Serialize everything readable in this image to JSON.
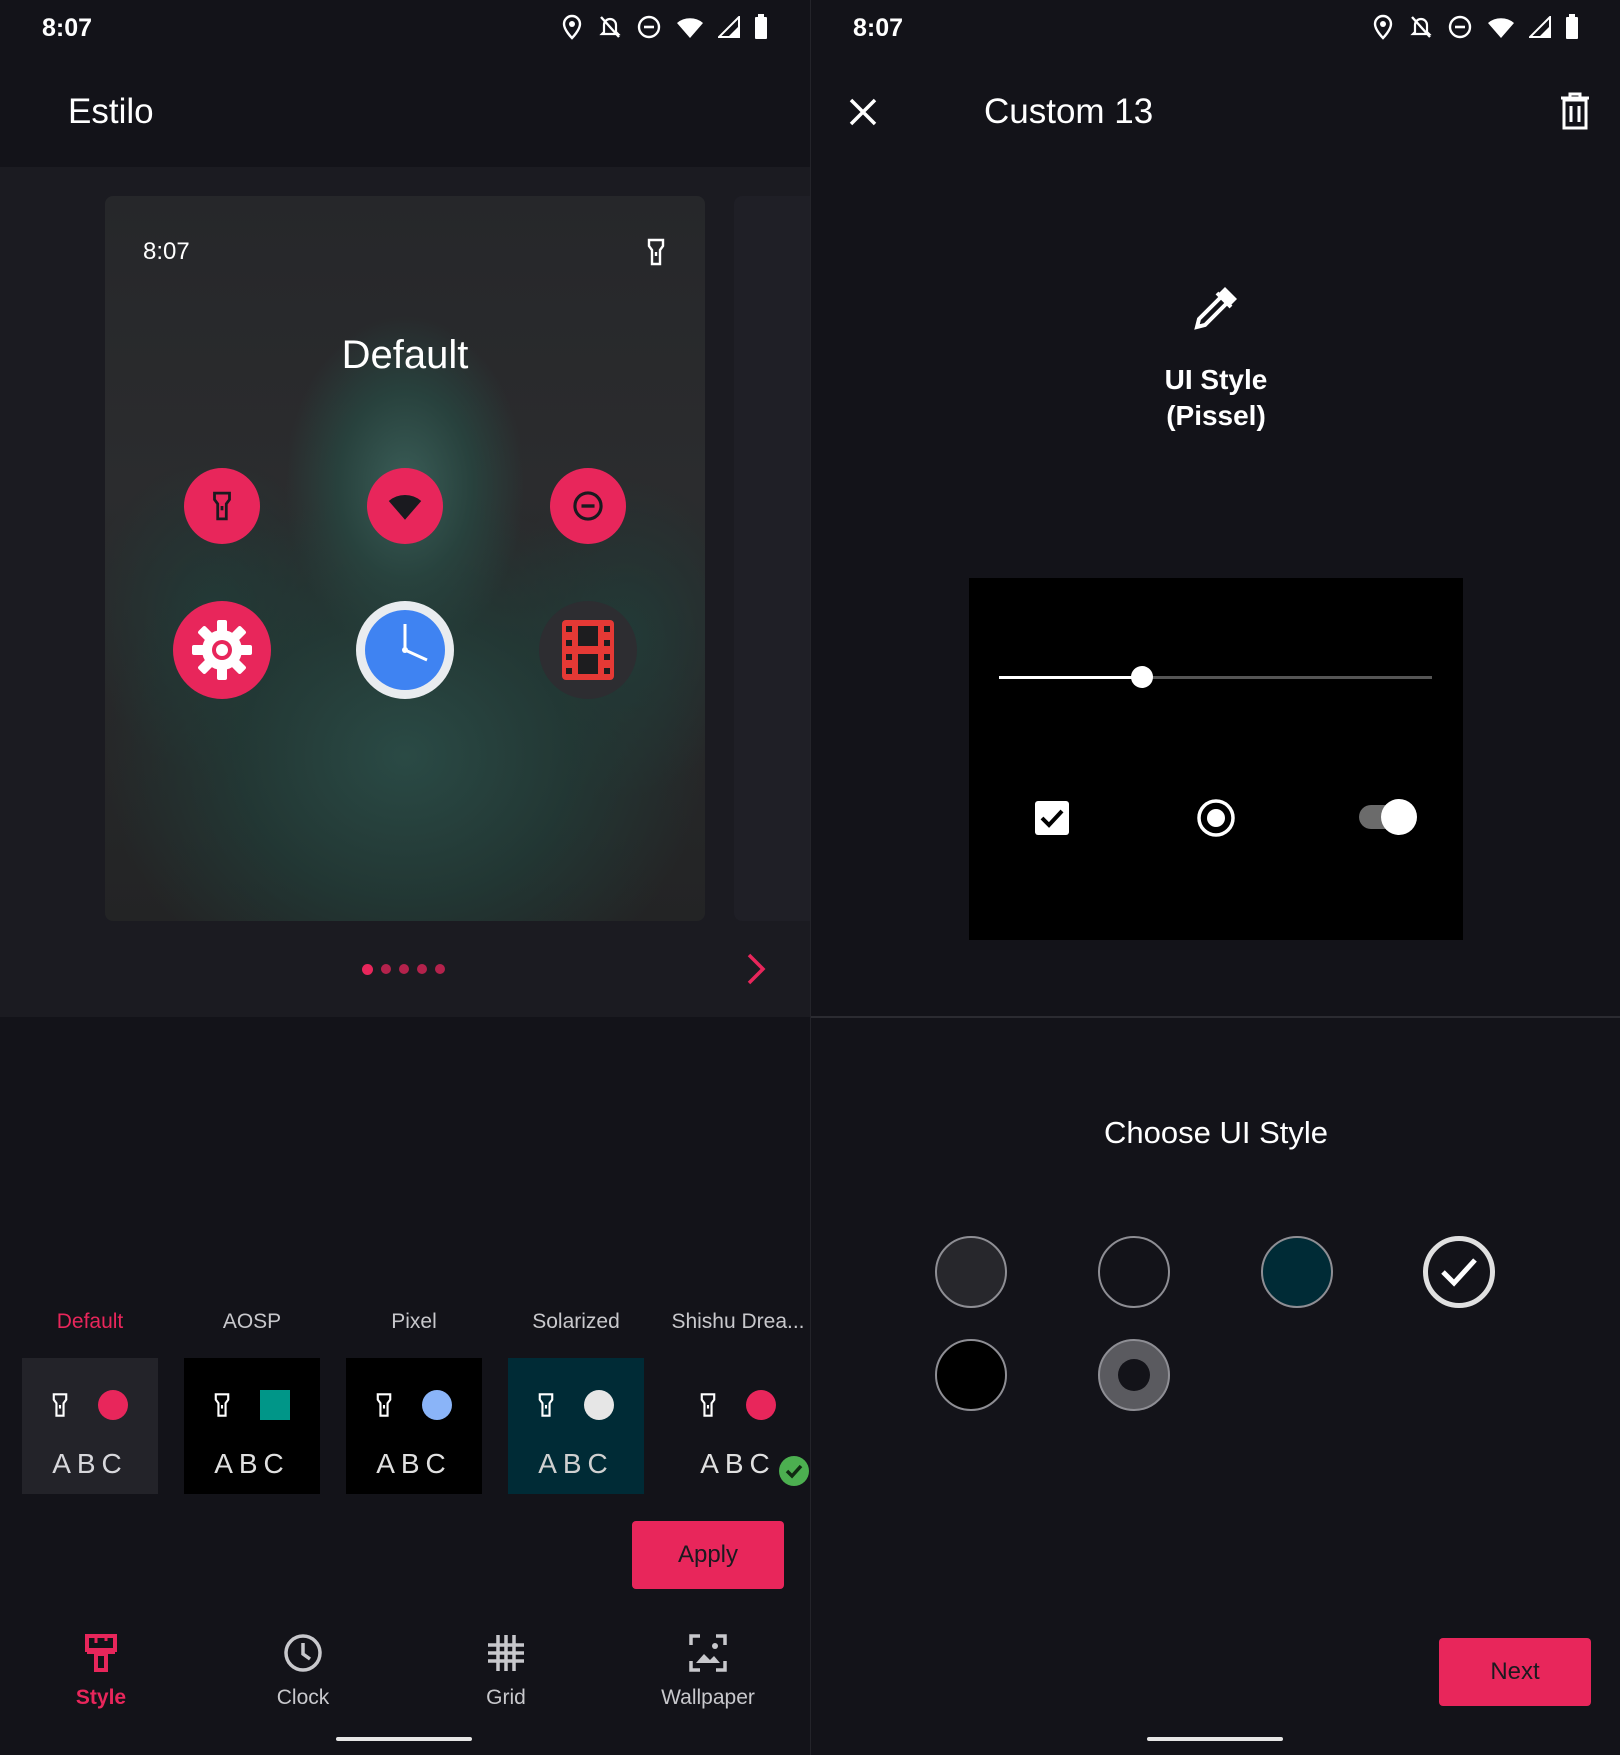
{
  "left": {
    "status": {
      "time": "8:07"
    },
    "title": "Estilo",
    "preview": {
      "time": "8:07",
      "style_name": "Default",
      "quick_settings": [
        "flashlight-icon",
        "wifi-icon",
        "do-not-disturb-icon"
      ],
      "apps": [
        "settings-app-icon",
        "clock-app-icon",
        "video-app-icon"
      ],
      "page_count": 5,
      "current_page": 1
    },
    "themes": [
      {
        "label": "Default",
        "abc": "ABC",
        "selected": true,
        "bg": "#232329",
        "accent": "#e8265b",
        "shape": "circle"
      },
      {
        "label": "AOSP",
        "abc": "ABC",
        "selected": false,
        "bg": "#000000",
        "accent": "#009688",
        "shape": "square"
      },
      {
        "label": "Pixel",
        "abc": "ABC",
        "selected": false,
        "bg": "#000000",
        "accent": "#8ab4f8",
        "shape": "circle"
      },
      {
        "label": "Solarized",
        "abc": "ABC",
        "selected": false,
        "bg": "#002b36",
        "accent": "#e6e6e6",
        "shape": "circle"
      },
      {
        "label": "Shishu Drea...",
        "abc": "ABC",
        "selected": false,
        "bg": "#131319",
        "accent": "#e8265b",
        "shape": "circle",
        "applied": true
      }
    ],
    "apply_label": "Apply",
    "nav": [
      {
        "label": "Style",
        "icon": "brush-icon",
        "selected": true
      },
      {
        "label": "Clock",
        "icon": "clock-icon",
        "selected": false
      },
      {
        "label": "Grid",
        "icon": "grid-icon",
        "selected": false
      },
      {
        "label": "Wallpaper",
        "icon": "wallpaper-icon",
        "selected": false
      }
    ]
  },
  "right": {
    "status": {
      "time": "8:07"
    },
    "title": "Custom 13",
    "ui_style_line1": "UI Style",
    "ui_style_line2": "(Pissel)",
    "preview": {
      "slider_value": 0.33,
      "checkbox_checked": true,
      "radio_selected": true,
      "switch_on": true
    },
    "choose_title": "Choose UI Style",
    "swatches": [
      {
        "name": "dark-grey",
        "color": "#27272c",
        "selected": false
      },
      {
        "name": "dark",
        "color": "#131319",
        "selected": false
      },
      {
        "name": "solarized",
        "color": "#002b36",
        "selected": false
      },
      {
        "name": "pissel",
        "color": "#131319",
        "selected": true
      },
      {
        "name": "black",
        "color": "#000000",
        "selected": false
      },
      {
        "name": "grey-ring",
        "color": "#5a5a5f",
        "selected": false
      }
    ],
    "next_label": "Next"
  },
  "colors": {
    "accent": "#e8265b",
    "background": "#131319",
    "surface": "#1b1b21"
  }
}
